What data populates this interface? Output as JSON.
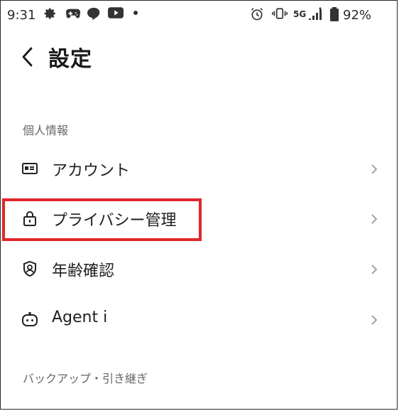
{
  "status_bar": {
    "time": "9:31",
    "network": "5G",
    "battery": "92%"
  },
  "header": {
    "title": "設定"
  },
  "sections": [
    {
      "label": "個人情報"
    },
    {
      "label": "バックアップ・引き継ぎ"
    }
  ],
  "items": [
    {
      "label": "アカウント",
      "icon": "id-card-icon"
    },
    {
      "label": "プライバシー管理",
      "icon": "lock-icon"
    },
    {
      "label": "年齢確認",
      "icon": "shield-icon"
    },
    {
      "label": "Agent i",
      "icon": "robot-icon"
    }
  ],
  "colors": {
    "highlight": "#e0262b",
    "text": "#1f1f1f",
    "section_label": "#666666",
    "chevron": "#9a9a9a"
  }
}
